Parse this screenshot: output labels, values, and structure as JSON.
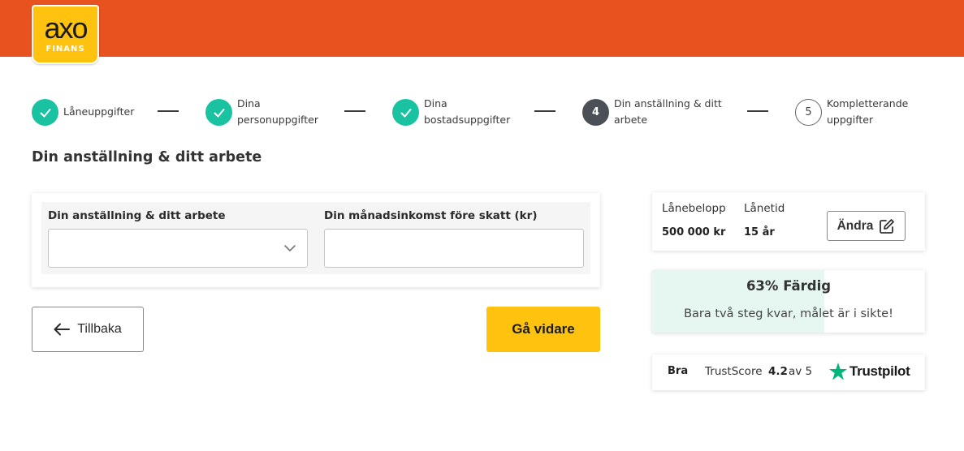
{
  "brand": {
    "name": "axo",
    "subtitle": "FINANS"
  },
  "colors": {
    "header": "#e8521f",
    "accent": "#ffc20e",
    "done": "#19c2a0",
    "active_step": "#4a5056",
    "progress_fill": "#e6f7f2",
    "trustpilot_star": "#00b67a"
  },
  "steps": [
    {
      "status": "done",
      "number": "",
      "label": "Låneuppgifter"
    },
    {
      "status": "done",
      "number": "",
      "label": "Dina personuppgifter"
    },
    {
      "status": "done",
      "number": "",
      "label": "Dina bostadsuppgifter"
    },
    {
      "status": "active",
      "number": "4",
      "label": "Din anställning & ditt arbete"
    },
    {
      "status": "todo",
      "number": "5",
      "label": "Kompletterande uppgifter"
    }
  ],
  "page_title": "Din anställning & ditt arbete",
  "form": {
    "employment_label": "Din anställning & ditt arbete",
    "employment_value": "",
    "income_label": "Din månadsinkomst före skatt (kr)",
    "income_value": ""
  },
  "nav": {
    "back_label": "Tillbaka",
    "next_label": "Gå vidare"
  },
  "loan": {
    "amount_label": "Lånebelopp",
    "amount_value": "500 000 kr",
    "term_label": "Lånetid",
    "term_value": "15 år",
    "edit_label": "Ändra"
  },
  "progress": {
    "percent": 63,
    "title": "63% Färdig",
    "subtitle": "Bara två steg kvar, målet är i sikte!"
  },
  "trust": {
    "rating_word": "Bra",
    "label": "TrustScore",
    "score": "4.2",
    "of": "av 5",
    "brand": "Trustpilot"
  }
}
